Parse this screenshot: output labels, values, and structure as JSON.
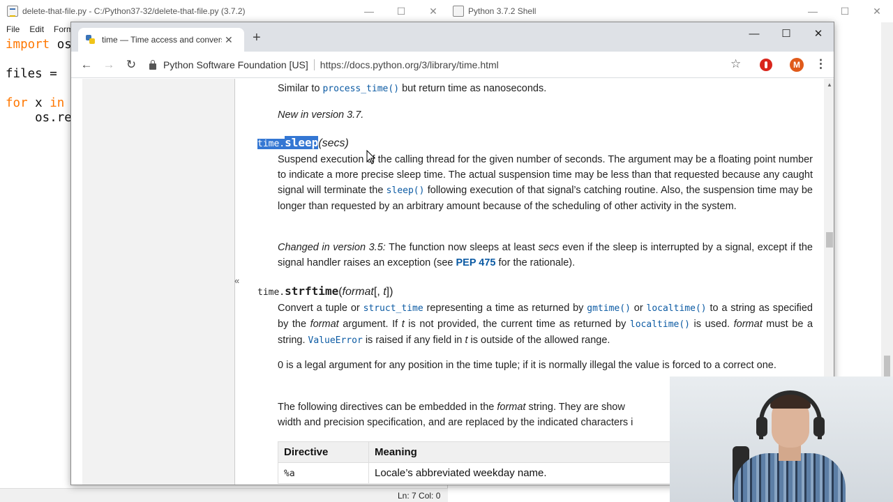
{
  "idle": {
    "title": "delete-that-file.py - C:/Python37-32/delete-that-file.py (3.7.2)",
    "menu": [
      "File",
      "Edit",
      "Form"
    ],
    "code": {
      "l1_kw": "import",
      "l1_rest": " os",
      "l2": "files = ",
      "l3_kw1": "for",
      "l3_mid": " x ",
      "l3_kw2": "in",
      "l4": "    os.re"
    },
    "status": "Ln: 7   Col: 0"
  },
  "shell": {
    "title": "Python 3.7.2 Shell"
  },
  "chrome": {
    "tab_title": "time — Time access and conversi",
    "org": "Python Software Foundation [US]",
    "url": "https://docs.python.org/3/library/time.html",
    "avatar_letter": "M",
    "colors": {
      "accent": "#0b5aa3",
      "selection": "#3477d3",
      "avatar": "#e05a1a"
    }
  },
  "doc": {
    "p1_a": "Similar to ",
    "p1_code": "process_time()",
    "p1_b": " but return time as nanoseconds.",
    "p2": "New in version 3.7.",
    "sleep_pre": "time.",
    "sleep_name": "sleep",
    "sleep_args": "(secs)",
    "p3_a": "Suspend execution of the calling thread for the given number of seconds. The argument may be a floating point number to indicate a more precise sleep time. The actual suspension time may be less than that requested because any caught signal will terminate the ",
    "p3_code": "sleep()",
    "p3_b": " following execution of that signal’s catching routine. Also, the suspension time may be longer than requested by an arbitrary amount because of the scheduling of other activity in the system.",
    "p4_em": "Changed in version 3.5:",
    "p4_a": " The function now sleeps at least ",
    "p4_em2": "secs",
    "p4_b": " even if the sleep is interrupted by a signal, except if the signal handler raises an exception (see ",
    "p4_link": "PEP 475",
    "p4_c": " for the rationale).",
    "strf_pre": "time.",
    "strf_name": "strftime",
    "strf_args_a": "(",
    "strf_args_em": "format",
    "strf_args_b": "[, ",
    "strf_args_em2": "t",
    "strf_args_c": "])",
    "p5_a": "Convert a tuple or ",
    "p5_code1": "struct_time",
    "p5_b": " representing a time as returned by ",
    "p5_code2": "gmtime()",
    "p5_c": " or ",
    "p5_code3": "localtime()",
    "p5_d": " to a string as specified by the ",
    "p5_em": "format",
    "p5_e": " argument. If ",
    "p5_em2": "t",
    "p5_f": " is not provided, the current time as returned by ",
    "p5_code4": "localtime()",
    "p5_g": " is used. ",
    "p5_em3": "format",
    "p5_h": " must be a string. ",
    "p5_code5": "ValueError",
    "p5_i": " is raised if any field in ",
    "p5_em4": "t",
    "p5_j": " is outside of the allowed range.",
    "p6": "0 is a legal argument for any position in the time tuple; if it is normally illegal the value is forced to a correct one.",
    "p7_a": "The following directives can be embedded in the ",
    "p7_em": "format",
    "p7_b": " string. They are show",
    "p7_c": "width and precision specification, and are replaced by the indicated characters i",
    "table": {
      "h1": "Directive",
      "h2": "Meaning",
      "r1c1": "%a",
      "r1c2": "Locale’s abbreviated weekday name."
    }
  }
}
